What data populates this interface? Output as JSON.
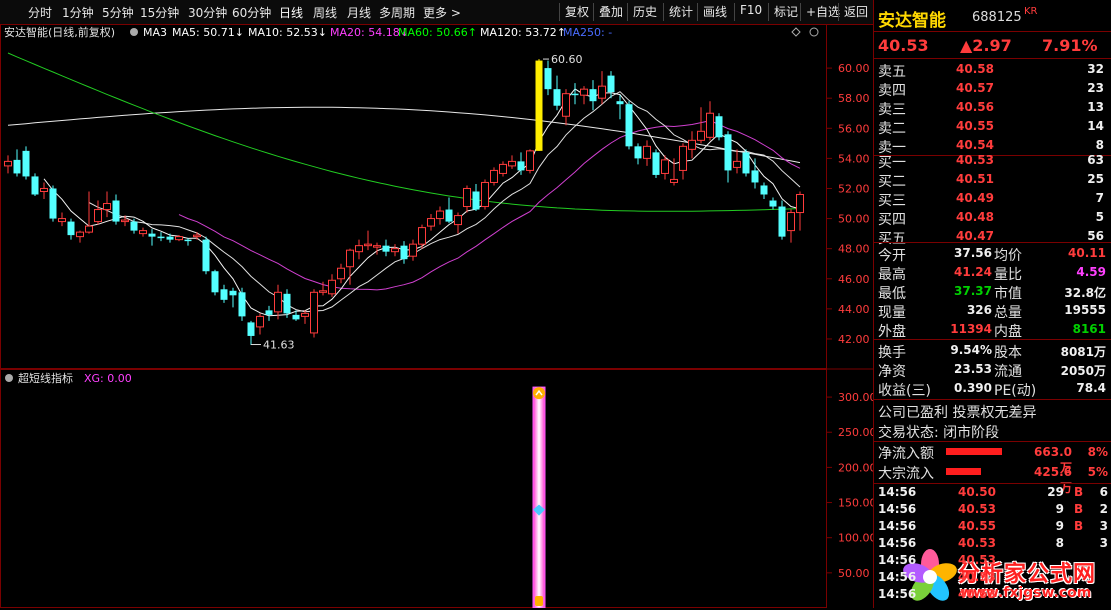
{
  "toolbar": {
    "left_tabs": [
      "分时",
      "1分钟",
      "5分钟",
      "15分钟",
      "30分钟",
      "60分钟",
      "日线",
      "周线",
      "月线",
      "多周期",
      "更多 >"
    ],
    "active_tab": "日线",
    "right_buttons": [
      "复权",
      "叠加",
      "历史",
      "统计",
      "画线",
      "F10",
      "标记",
      "+自选",
      "返回"
    ]
  },
  "legend": {
    "title": "安达智能(日线,前复权)",
    "items": [
      {
        "text": "MA3",
        "color": "#ffffff"
      },
      {
        "text": "MA5: 50.71↓",
        "color": "#ffffff"
      },
      {
        "text": "MA10: 52.53↓",
        "color": "#ffffff"
      },
      {
        "text": "MA20: 54.18↓",
        "color": "#ff40ff"
      },
      {
        "text": "MA60: 50.66↑",
        "color": "#00ff00"
      },
      {
        "text": "MA120: 53.72↑",
        "color": "#ffffff"
      },
      {
        "text": "MA250: -",
        "color": "#4a6cff"
      }
    ]
  },
  "sub_legend": {
    "title": "超短线指标",
    "xg": "XG: 0.00"
  },
  "chart_data": [
    {
      "type": "candlestick",
      "title": "安达智能(日线,前复权)",
      "ylim": [
        41,
        62
      ],
      "y_ticks": [
        "60.00",
        "58.00",
        "56.00",
        "54.00",
        "52.00",
        "50.00",
        "48.00",
        "46.00",
        "44.00",
        "42.00"
      ],
      "annotations": [
        {
          "text": "60.60"
        },
        {
          "text": "41.63"
        }
      ],
      "candles": [
        {
          "o": 53.5,
          "h": 54.2,
          "l": 53.0,
          "c": 53.8
        },
        {
          "o": 53.9,
          "h": 54.6,
          "l": 52.8,
          "c": 53.0
        },
        {
          "o": 54.5,
          "h": 54.8,
          "l": 52.6,
          "c": 52.8
        },
        {
          "o": 52.8,
          "h": 53.0,
          "l": 51.5,
          "c": 51.6
        },
        {
          "o": 51.8,
          "h": 52.4,
          "l": 51.3,
          "c": 52.0
        },
        {
          "o": 52.0,
          "h": 52.2,
          "l": 49.8,
          "c": 50.0
        },
        {
          "o": 49.8,
          "h": 50.4,
          "l": 49.5,
          "c": 50.0
        },
        {
          "o": 49.8,
          "h": 50.0,
          "l": 48.6,
          "c": 48.9
        },
        {
          "o": 48.8,
          "h": 49.2,
          "l": 48.4,
          "c": 49.1
        },
        {
          "o": 49.1,
          "h": 51.8,
          "l": 49.0,
          "c": 49.5
        },
        {
          "o": 49.8,
          "h": 51.2,
          "l": 49.6,
          "c": 50.6
        },
        {
          "o": 50.6,
          "h": 51.8,
          "l": 50.1,
          "c": 51.0
        },
        {
          "o": 51.2,
          "h": 51.6,
          "l": 49.6,
          "c": 49.8
        },
        {
          "o": 49.8,
          "h": 50.2,
          "l": 49.5,
          "c": 49.9
        },
        {
          "o": 49.8,
          "h": 50.0,
          "l": 49.0,
          "c": 49.2
        },
        {
          "o": 49.0,
          "h": 49.4,
          "l": 48.8,
          "c": 49.2
        },
        {
          "o": 49.0,
          "h": 49.3,
          "l": 48.2,
          "c": 48.8
        },
        {
          "o": 48.8,
          "h": 49.1,
          "l": 48.5,
          "c": 48.7
        },
        {
          "o": 48.8,
          "h": 49.0,
          "l": 48.4,
          "c": 48.6
        },
        {
          "o": 48.6,
          "h": 48.9,
          "l": 48.5,
          "c": 48.8
        },
        {
          "o": 48.6,
          "h": 48.7,
          "l": 48.2,
          "c": 48.5
        },
        {
          "o": 48.8,
          "h": 49.1,
          "l": 48.6,
          "c": 48.9
        },
        {
          "o": 48.6,
          "h": 48.8,
          "l": 46.3,
          "c": 46.5
        },
        {
          "o": 46.5,
          "h": 46.6,
          "l": 44.9,
          "c": 45.1
        },
        {
          "o": 45.3,
          "h": 45.6,
          "l": 44.4,
          "c": 44.6
        },
        {
          "o": 45.2,
          "h": 45.4,
          "l": 44.1,
          "c": 44.9
        },
        {
          "o": 45.1,
          "h": 45.4,
          "l": 43.2,
          "c": 43.5
        },
        {
          "o": 43.1,
          "h": 43.2,
          "l": 41.6,
          "c": 42.2
        },
        {
          "o": 42.8,
          "h": 43.7,
          "l": 42.3,
          "c": 43.5
        },
        {
          "o": 43.9,
          "h": 44.2,
          "l": 43.2,
          "c": 43.6
        },
        {
          "o": 43.8,
          "h": 45.6,
          "l": 43.3,
          "c": 45.1
        },
        {
          "o": 45.0,
          "h": 45.3,
          "l": 43.4,
          "c": 43.7
        },
        {
          "o": 43.6,
          "h": 43.9,
          "l": 43.2,
          "c": 43.3
        },
        {
          "o": 43.5,
          "h": 43.9,
          "l": 43.0,
          "c": 43.7
        },
        {
          "o": 42.4,
          "h": 45.3,
          "l": 42.1,
          "c": 45.1
        },
        {
          "o": 45.1,
          "h": 45.8,
          "l": 44.9,
          "c": 45.2
        },
        {
          "o": 45.0,
          "h": 46.3,
          "l": 44.8,
          "c": 45.9
        },
        {
          "o": 46.0,
          "h": 47.0,
          "l": 45.7,
          "c": 46.7
        },
        {
          "o": 46.8,
          "h": 48.0,
          "l": 45.6,
          "c": 47.9
        },
        {
          "o": 47.8,
          "h": 48.6,
          "l": 47.3,
          "c": 48.2
        },
        {
          "o": 48.2,
          "h": 49.2,
          "l": 47.9,
          "c": 48.3
        },
        {
          "o": 48.1,
          "h": 48.4,
          "l": 47.6,
          "c": 48.2
        },
        {
          "o": 48.2,
          "h": 48.6,
          "l": 47.5,
          "c": 47.8
        },
        {
          "o": 47.8,
          "h": 48.3,
          "l": 47.5,
          "c": 48.0
        },
        {
          "o": 48.2,
          "h": 48.5,
          "l": 47.0,
          "c": 47.3
        },
        {
          "o": 47.5,
          "h": 48.6,
          "l": 47.2,
          "c": 48.3
        },
        {
          "o": 48.3,
          "h": 49.6,
          "l": 48.0,
          "c": 49.4
        },
        {
          "o": 49.5,
          "h": 50.3,
          "l": 49.2,
          "c": 50.0
        },
        {
          "o": 50.0,
          "h": 50.8,
          "l": 49.6,
          "c": 50.5
        },
        {
          "o": 50.6,
          "h": 51.4,
          "l": 49.7,
          "c": 49.8
        },
        {
          "o": 49.6,
          "h": 50.4,
          "l": 49.0,
          "c": 50.2
        },
        {
          "o": 50.8,
          "h": 52.2,
          "l": 50.4,
          "c": 52.0
        },
        {
          "o": 51.8,
          "h": 52.3,
          "l": 50.5,
          "c": 50.6
        },
        {
          "o": 50.8,
          "h": 52.6,
          "l": 50.6,
          "c": 52.4
        },
        {
          "o": 52.4,
          "h": 53.4,
          "l": 52.2,
          "c": 53.2
        },
        {
          "o": 53.0,
          "h": 53.8,
          "l": 52.8,
          "c": 53.6
        },
        {
          "o": 53.5,
          "h": 54.2,
          "l": 53.3,
          "c": 53.8
        },
        {
          "o": 53.8,
          "h": 54.4,
          "l": 52.9,
          "c": 53.2
        },
        {
          "o": 53.2,
          "h": 54.6,
          "l": 53.0,
          "c": 54.5
        },
        {
          "o": 54.5,
          "h": 60.6,
          "l": 54.5,
          "c": 60.5
        },
        {
          "o": 60.0,
          "h": 60.5,
          "l": 58.2,
          "c": 58.6
        },
        {
          "o": 58.6,
          "h": 59.5,
          "l": 57.2,
          "c": 57.5
        },
        {
          "o": 56.8,
          "h": 58.6,
          "l": 56.2,
          "c": 58.3
        },
        {
          "o": 58.3,
          "h": 59.0,
          "l": 57.6,
          "c": 58.2
        },
        {
          "o": 58.2,
          "h": 58.8,
          "l": 57.6,
          "c": 58.6
        },
        {
          "o": 58.6,
          "h": 59.2,
          "l": 57.2,
          "c": 57.8
        },
        {
          "o": 58.0,
          "h": 59.8,
          "l": 57.6,
          "c": 58.8
        },
        {
          "o": 59.5,
          "h": 59.8,
          "l": 58.0,
          "c": 58.4
        },
        {
          "o": 57.8,
          "h": 58.2,
          "l": 56.6,
          "c": 57.6
        },
        {
          "o": 57.6,
          "h": 57.8,
          "l": 54.6,
          "c": 54.8
        },
        {
          "o": 54.8,
          "h": 55.0,
          "l": 53.6,
          "c": 54.0
        },
        {
          "o": 54.0,
          "h": 55.2,
          "l": 53.5,
          "c": 54.8
        },
        {
          "o": 54.4,
          "h": 54.6,
          "l": 52.7,
          "c": 52.9
        },
        {
          "o": 53.0,
          "h": 54.2,
          "l": 52.6,
          "c": 53.9
        },
        {
          "o": 52.4,
          "h": 54.0,
          "l": 52.2,
          "c": 52.6
        },
        {
          "o": 53.2,
          "h": 55.0,
          "l": 52.6,
          "c": 54.8
        },
        {
          "o": 54.6,
          "h": 55.8,
          "l": 54.0,
          "c": 55.2
        },
        {
          "o": 55.2,
          "h": 57.4,
          "l": 55.0,
          "c": 55.8
        },
        {
          "o": 55.4,
          "h": 57.8,
          "l": 55.2,
          "c": 57.0
        },
        {
          "o": 56.8,
          "h": 57.0,
          "l": 55.2,
          "c": 55.4
        },
        {
          "o": 55.6,
          "h": 55.8,
          "l": 52.4,
          "c": 53.2
        },
        {
          "o": 53.4,
          "h": 54.6,
          "l": 53.0,
          "c": 53.8
        },
        {
          "o": 54.4,
          "h": 54.6,
          "l": 52.8,
          "c": 53.0
        },
        {
          "o": 53.2,
          "h": 54.0,
          "l": 52.0,
          "c": 52.4
        },
        {
          "o": 52.2,
          "h": 52.4,
          "l": 51.3,
          "c": 51.6
        },
        {
          "o": 51.2,
          "h": 51.4,
          "l": 50.6,
          "c": 50.8
        },
        {
          "o": 50.8,
          "h": 51.2,
          "l": 48.6,
          "c": 48.8
        },
        {
          "o": 49.2,
          "h": 50.6,
          "l": 48.4,
          "c": 50.4
        },
        {
          "o": 50.4,
          "h": 51.8,
          "l": 49.2,
          "c": 51.6
        }
      ]
    },
    {
      "type": "bar",
      "title": "超短线指标",
      "ylim": [
        0,
        330
      ],
      "y_ticks": [
        "300.00",
        "250.00",
        "200.00",
        "150.00",
        "100.00",
        "50.00"
      ],
      "values": [
        {
          "index": 59,
          "value": 300,
          "marker_top": "up-arrow",
          "marker_mid_value": 140,
          "marker_bottom": "hand"
        }
      ]
    }
  ],
  "quote": {
    "name": "安达智能",
    "code": "688125",
    "tag": "KR",
    "price": "40.53",
    "change": "▲2.97",
    "pct": "7.91%",
    "asks": [
      {
        "label": "卖五",
        "price": "40.58",
        "vol": "32"
      },
      {
        "label": "卖四",
        "price": "40.57",
        "vol": "23"
      },
      {
        "label": "卖三",
        "price": "40.56",
        "vol": "13"
      },
      {
        "label": "卖二",
        "price": "40.55",
        "vol": "14"
      },
      {
        "label": "卖一",
        "price": "40.54",
        "vol": "8"
      }
    ],
    "bids": [
      {
        "label": "买一",
        "price": "40.53",
        "vol": "63"
      },
      {
        "label": "买二",
        "price": "40.51",
        "vol": "25"
      },
      {
        "label": "买三",
        "price": "40.49",
        "vol": "7"
      },
      {
        "label": "买四",
        "price": "40.48",
        "vol": "5"
      },
      {
        "label": "买五",
        "price": "40.47",
        "vol": "56"
      }
    ],
    "stats": [
      {
        "l1": "今开",
        "v1": "37.56",
        "c1": "wht",
        "l2": "均价",
        "v2": "40.11",
        "c2": "red"
      },
      {
        "l1": "最高",
        "v1": "41.24",
        "c1": "red",
        "l2": "量比",
        "v2": "4.59",
        "c2": "mag"
      },
      {
        "l1": "最低",
        "v1": "37.37",
        "c1": "grn",
        "l2": "市值",
        "v2": "32.8亿",
        "c2": "wht"
      },
      {
        "l1": "现量",
        "v1": "326",
        "c1": "wht",
        "l2": "总量",
        "v2": "19555",
        "c2": "wht"
      },
      {
        "l1": "外盘",
        "v1": "11394",
        "c1": "red",
        "l2": "内盘",
        "v2": "8161",
        "c2": "grn"
      }
    ],
    "stats2": [
      {
        "l1": "换手",
        "v1": "9.54%",
        "l2": "股本",
        "v2": "8081万"
      },
      {
        "l1": "净资",
        "v1": "23.53",
        "l2": "流通",
        "v2": "2050万"
      },
      {
        "l1": "收益(三)",
        "v1": "0.390",
        "l2": "PE(动)",
        "v2": "78.4"
      }
    ],
    "notes": [
      "公司已盈利 投票权无差异",
      "交易状态: 闭市阶段"
    ],
    "flows": [
      {
        "label": "净流入额",
        "value": "663.0万",
        "pct": "8%",
        "level": 0.8
      },
      {
        "label": "大宗流入",
        "value": "425.6万",
        "pct": "5%",
        "level": 0.5
      }
    ],
    "ticks": [
      {
        "time": "14:56",
        "price": "40.50",
        "vol": "29",
        "side": "B",
        "n": "6"
      },
      {
        "time": "14:56",
        "price": "40.53",
        "vol": "9",
        "side": "B",
        "n": "2"
      },
      {
        "time": "14:56",
        "price": "40.55",
        "vol": "9",
        "side": "B",
        "n": "3"
      },
      {
        "time": "14:56",
        "price": "40.53",
        "vol": "8",
        "side": "",
        "n": "3"
      },
      {
        "time": "14:56",
        "price": "40.53",
        "vol": "",
        "side": "",
        "n": ""
      },
      {
        "time": "14:56",
        "price": "40.53",
        "vol": "",
        "side": "",
        "n": ""
      },
      {
        "time": "14:56",
        "price": "40.53",
        "vol": "",
        "side": "",
        "n": ""
      }
    ]
  },
  "watermark": {
    "cn": "分析家公式网",
    "url": "www.fxjgsw.com"
  }
}
